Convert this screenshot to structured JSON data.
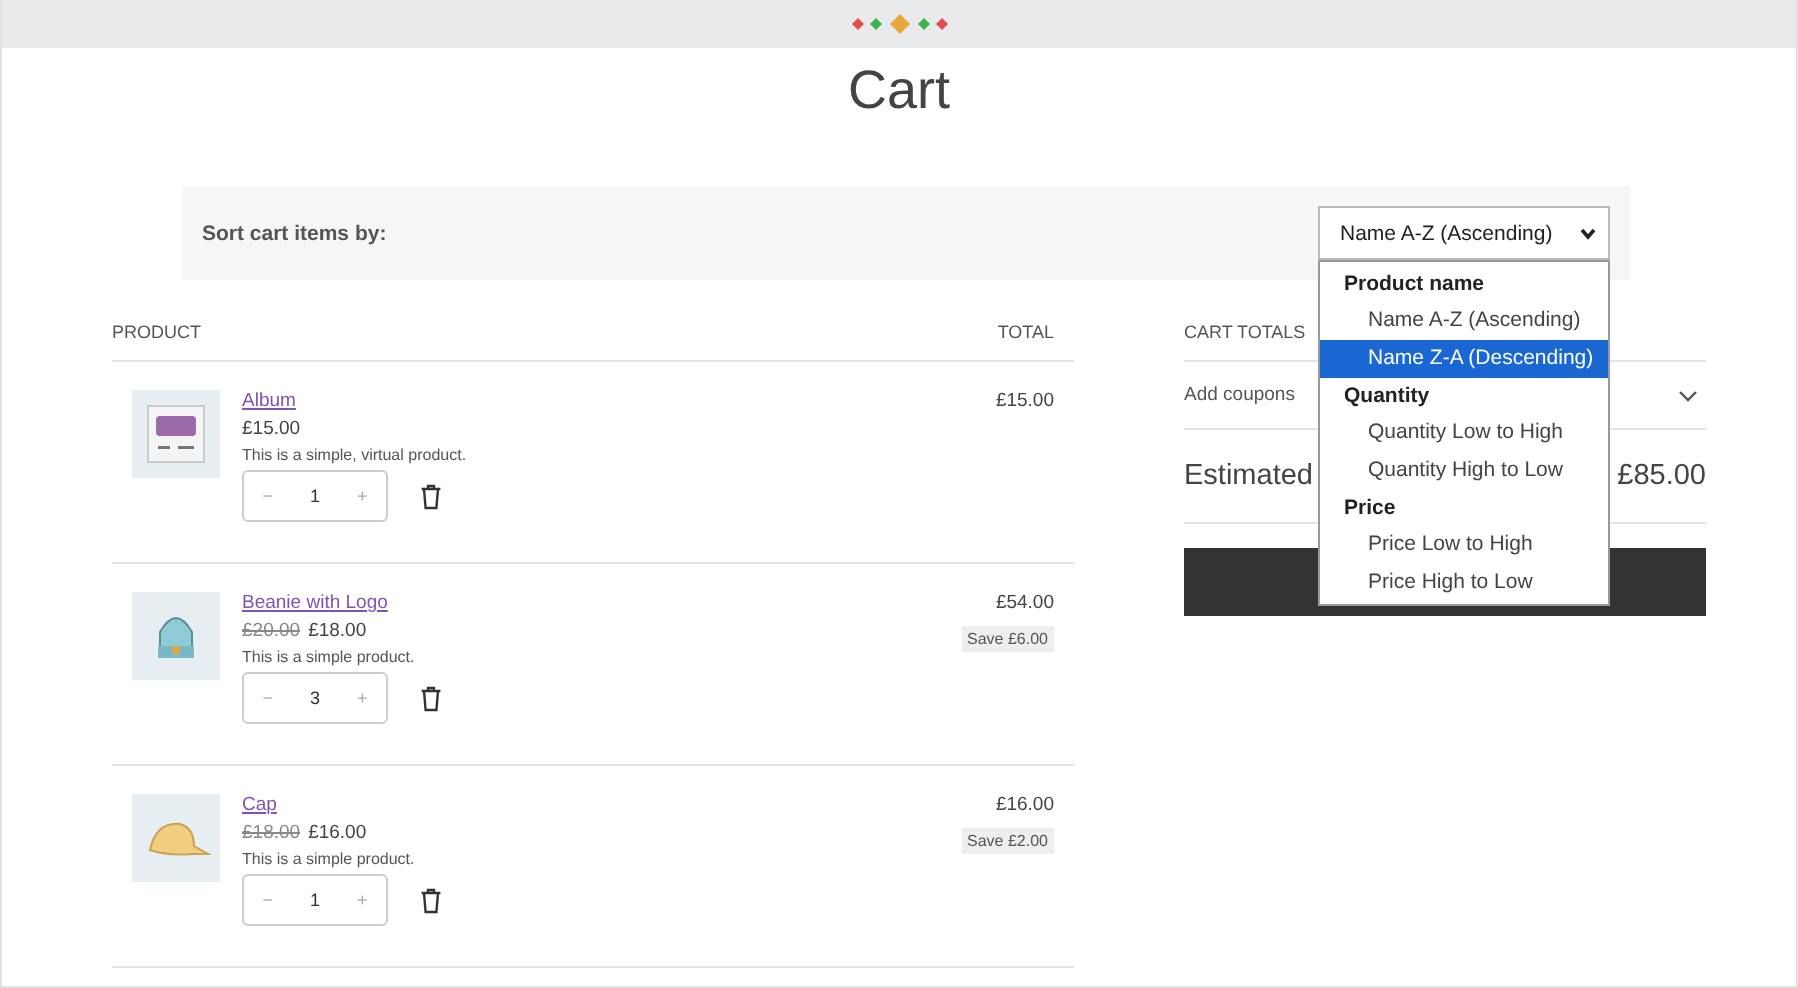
{
  "page_title": "Cart",
  "sort": {
    "label": "Sort cart items by:",
    "value": "Name A-Z (Ascending)",
    "expanded": true,
    "groups": [
      {
        "label": "Product name",
        "options": [
          {
            "label": "Name A-Z (Ascending)",
            "selected": false
          },
          {
            "label": "Name Z-A (Descending)",
            "selected": true
          }
        ]
      },
      {
        "label": "Quantity",
        "options": [
          {
            "label": "Quantity Low to High",
            "selected": false
          },
          {
            "label": "Quantity High to Low",
            "selected": false
          }
        ]
      },
      {
        "label": "Price",
        "options": [
          {
            "label": "Price Low to High",
            "selected": false
          },
          {
            "label": "Price High to Low",
            "selected": false
          }
        ]
      }
    ]
  },
  "table": {
    "columns": [
      "PRODUCT",
      "TOTAL"
    ],
    "rows": [
      {
        "name": "Album",
        "price": "£15.00",
        "description": "This is a simple, virtual product.",
        "quantity": "1",
        "minus": "−",
        "plus": "+",
        "total": "£15.00",
        "kind": "album"
      },
      {
        "name": "Beanie with Logo",
        "regular_price": "£20.00",
        "sale_price": "£18.00",
        "description": "This is a simple product.",
        "quantity": "3",
        "minus": "−",
        "plus": "+",
        "total": "£54.00",
        "save": "Save £6.00",
        "kind": "beanie"
      },
      {
        "name": "Cap",
        "regular_price": "£18.00",
        "sale_price": "£16.00",
        "description": "This is a simple product.",
        "quantity": "1",
        "minus": "−",
        "plus": "+",
        "total": "£16.00",
        "save": "Save £2.00",
        "kind": "cap"
      }
    ]
  },
  "totals": {
    "heading": "CART TOTALS",
    "coupons": "Add coupons",
    "estimated_label": "Estimated",
    "estimated_value": "£85.00"
  }
}
